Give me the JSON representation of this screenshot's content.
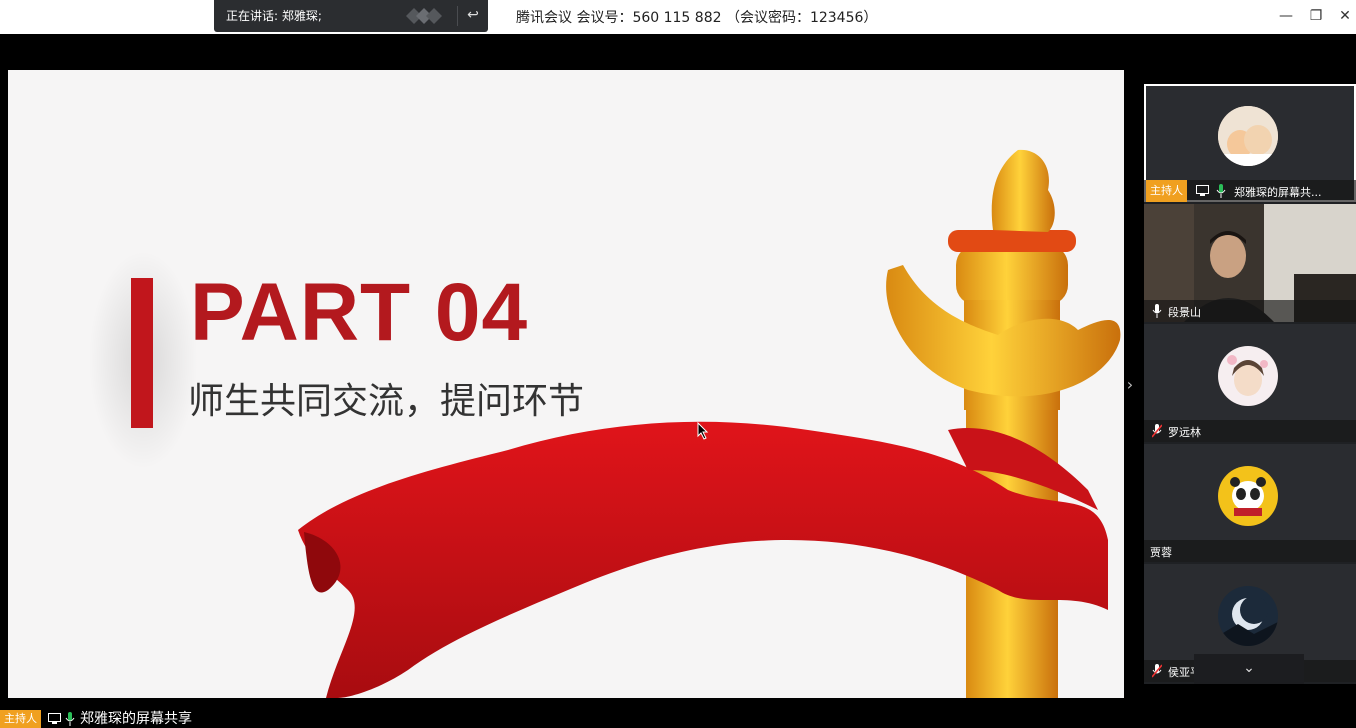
{
  "titlebar": {
    "title": "腾讯会议 会议号：560 115 882 （会议密码：123456）",
    "speaking": "正在讲话: 郑雅琛;",
    "minimize": "—",
    "restore": "❐",
    "close": "✕"
  },
  "slide": {
    "heading": "PART 04",
    "subtitle": "师生共同交流，提问环节"
  },
  "panel": {
    "expand_arrow": "›",
    "collapse_arrow": "⌄",
    "participants": [
      {
        "name": "郑雅琛的屏幕共...",
        "is_host": true,
        "host_label": "主持人",
        "sharing": true,
        "muted": false
      },
      {
        "name": "段景山",
        "is_host": false,
        "muted": false
      },
      {
        "name": "罗远林",
        "is_host": false,
        "muted": true
      },
      {
        "name": "贾蓉",
        "is_host": false,
        "muted": false
      },
      {
        "name": "侯亚平",
        "is_host": false,
        "muted": true
      }
    ]
  },
  "bottombar": {
    "host_label": "主持人",
    "name": "郑雅琛的屏幕共享"
  },
  "colors": {
    "accent_red": "#c1161c",
    "host_orange": "#f0a020",
    "mic_green": "#2bbf5a"
  }
}
